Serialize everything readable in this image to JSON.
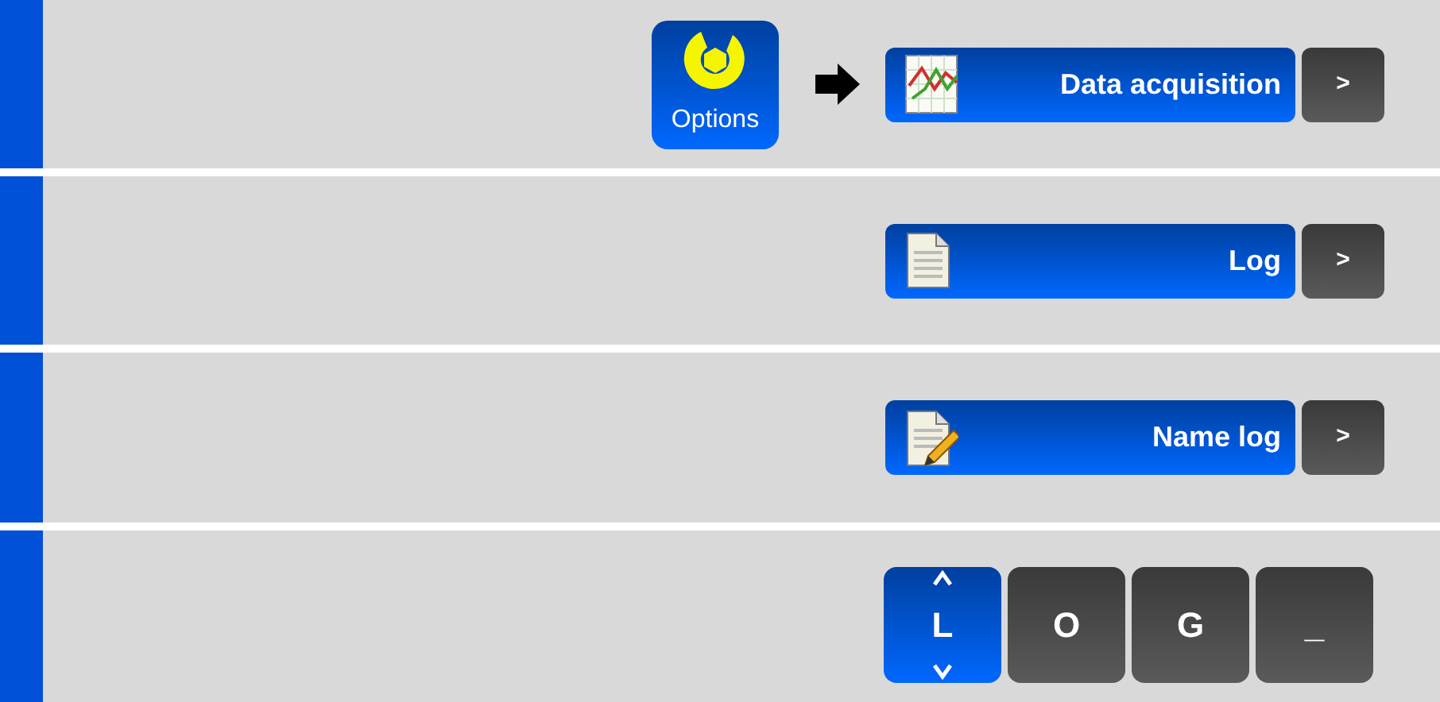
{
  "steps": [
    {
      "kind": "menu",
      "options_button": {
        "label": "Options"
      },
      "item": {
        "label": "Data acquisition"
      },
      "more": ">"
    },
    {
      "kind": "menu",
      "item": {
        "label": "Log"
      },
      "more": ">"
    },
    {
      "kind": "menu",
      "item": {
        "label": "Name log"
      },
      "more": ">"
    },
    {
      "kind": "keys",
      "keys": [
        {
          "label": "L",
          "selected": true
        },
        {
          "label": "O",
          "selected": false
        },
        {
          "label": "G",
          "selected": false
        },
        {
          "label": "_",
          "selected": false
        }
      ]
    }
  ]
}
